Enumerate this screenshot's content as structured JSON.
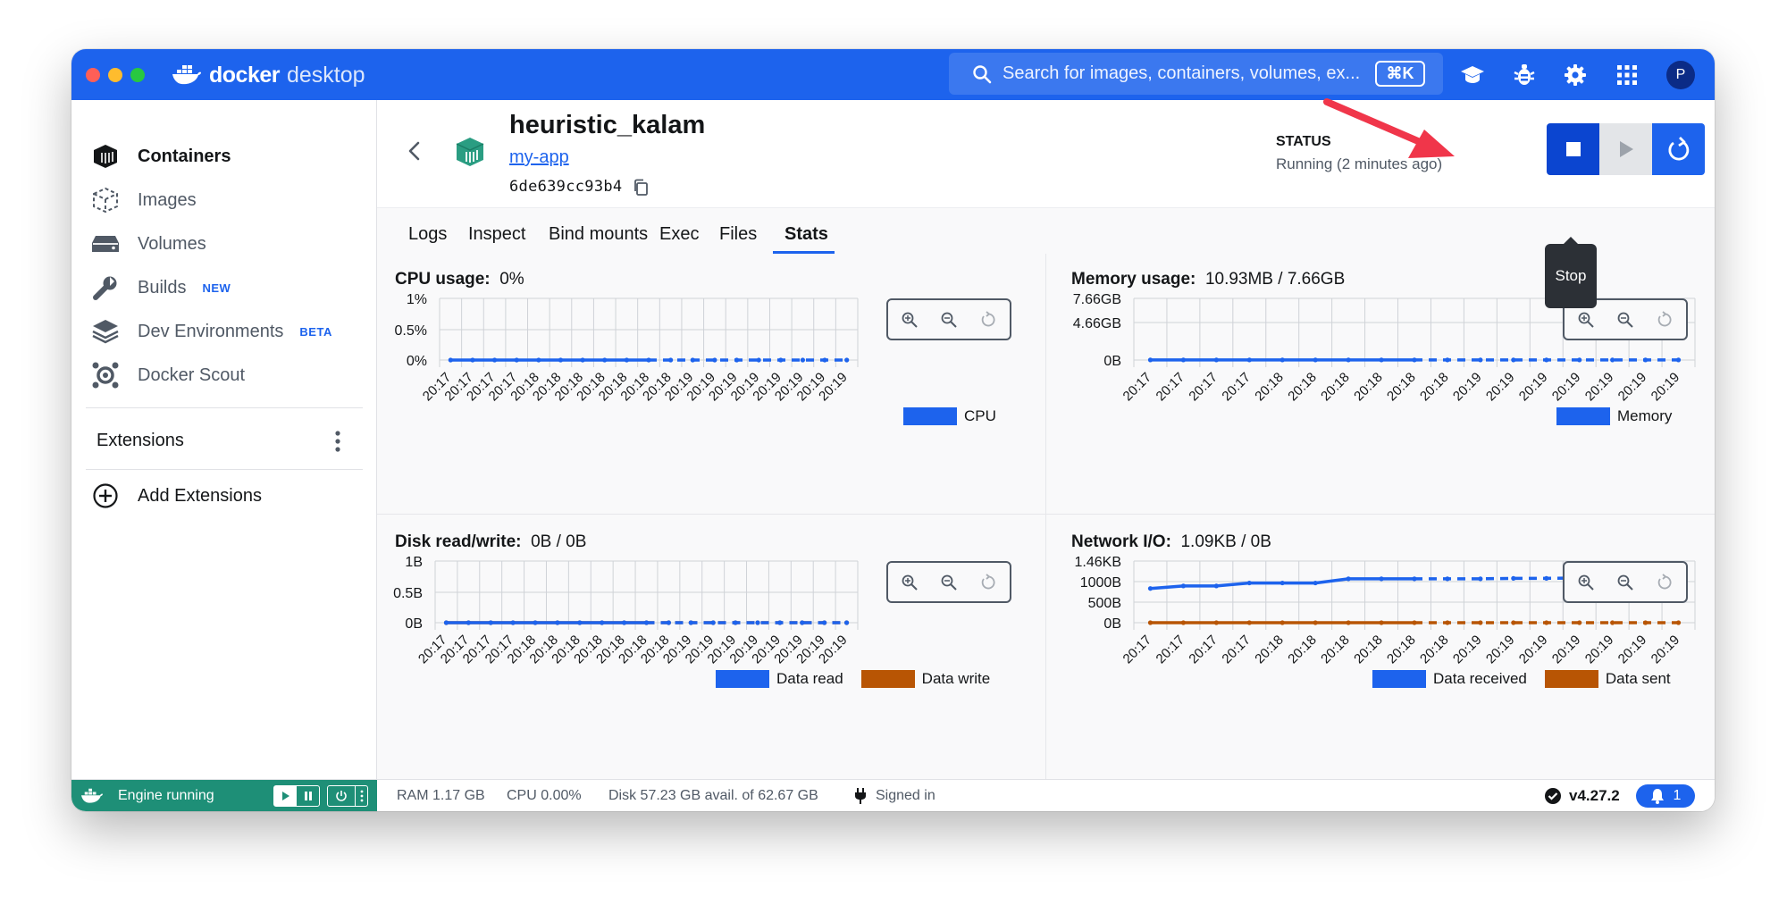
{
  "app": {
    "brand_bold": "docker",
    "brand_light": "desktop",
    "search_placeholder": "Search for images, containers, volumes, ex...",
    "search_shortcut": "⌘K",
    "avatar_initial": "P"
  },
  "sidebar": {
    "items": [
      {
        "label": "Containers",
        "icon": "containers-icon",
        "badge": ""
      },
      {
        "label": "Images",
        "icon": "images-icon",
        "badge": ""
      },
      {
        "label": "Volumes",
        "icon": "volumes-icon",
        "badge": ""
      },
      {
        "label": "Builds",
        "icon": "builds-icon",
        "badge": "NEW"
      },
      {
        "label": "Dev Environments",
        "icon": "dev-environments-icon",
        "badge": "BETA"
      },
      {
        "label": "Docker Scout",
        "icon": "docker-scout-icon",
        "badge": ""
      }
    ],
    "extensions_label": "Extensions",
    "add_extensions_label": "Add Extensions"
  },
  "container": {
    "name": "heuristic_kalam",
    "image": "my-app",
    "id": "6de639cc93b4",
    "status_label": "STATUS",
    "status_value": "Running (2 minutes ago)"
  },
  "controls": {
    "stop_tooltip": "Stop"
  },
  "tabs": [
    "Logs",
    "Inspect",
    "Bind mounts",
    "Exec",
    "Files",
    "Stats"
  ],
  "active_tab": "Stats",
  "colors": {
    "primary_blue": "#1d63ed",
    "data_write_orange": "#b85504",
    "delete_red": "#d52536",
    "engine_green": "#1e8f77"
  },
  "chart_data": [
    {
      "type": "line",
      "title_label": "CPU usage:",
      "title_value": "0%",
      "x": [
        "20:17",
        "20:17",
        "20:17",
        "20:17",
        "20:18",
        "20:18",
        "20:18",
        "20:18",
        "20:18",
        "20:18",
        "20:18",
        "20:19",
        "20:19",
        "20:19",
        "20:19",
        "20:19",
        "20:19",
        "20:19",
        "20:19"
      ],
      "y_ticks": [
        "1%",
        "0.5%",
        "0%"
      ],
      "ylim": [
        0,
        1
      ],
      "series": [
        {
          "name": "CPU",
          "values": [
            0,
            0,
            0,
            0,
            0,
            0,
            0,
            0,
            0,
            0,
            0,
            0,
            0,
            0,
            0,
            0,
            0,
            0,
            0
          ],
          "color": "#1d63ed"
        }
      ]
    },
    {
      "type": "line",
      "title_label": "Memory usage:",
      "title_value": "10.93MB / 7.66GB",
      "x": [
        "20:17",
        "20:17",
        "20:17",
        "20:17",
        "20:18",
        "20:18",
        "20:18",
        "20:18",
        "20:18",
        "20:18",
        "20:19",
        "20:19",
        "20:19",
        "20:19",
        "20:19",
        "20:19",
        "20:19"
      ],
      "y_ticks": [
        "7.66GB",
        "4.66GB",
        "0B"
      ],
      "ylim": [
        0,
        7.66
      ],
      "series": [
        {
          "name": "Memory",
          "values": [
            0.011,
            0.011,
            0.011,
            0.011,
            0.011,
            0.011,
            0.011,
            0.011,
            0.011,
            0.011,
            0.011,
            0.011,
            0.011,
            0.011,
            0.011,
            0.011,
            0.011
          ],
          "color": "#1d63ed"
        }
      ]
    },
    {
      "type": "line",
      "title_label": "Disk read/write:",
      "title_value": "0B / 0B",
      "x": [
        "20:17",
        "20:17",
        "20:17",
        "20:17",
        "20:18",
        "20:18",
        "20:18",
        "20:18",
        "20:18",
        "20:18",
        "20:18",
        "20:19",
        "20:19",
        "20:19",
        "20:19",
        "20:19",
        "20:19",
        "20:19",
        "20:19"
      ],
      "y_ticks": [
        "1B",
        "0.5B",
        "0B"
      ],
      "ylim": [
        0,
        1
      ],
      "series": [
        {
          "name": "Data read",
          "values": [
            0,
            0,
            0,
            0,
            0,
            0,
            0,
            0,
            0,
            0,
            0,
            0,
            0,
            0,
            0,
            0,
            0,
            0,
            0
          ],
          "color": "#1d63ed"
        },
        {
          "name": "Data write",
          "values": [
            0,
            0,
            0,
            0,
            0,
            0,
            0,
            0,
            0,
            0,
            0,
            0,
            0,
            0,
            0,
            0,
            0,
            0,
            0
          ],
          "color": "#b85504"
        }
      ]
    },
    {
      "type": "line",
      "title_label": "Network I/O:",
      "title_value": "1.09KB / 0B",
      "x": [
        "20:17",
        "20:17",
        "20:17",
        "20:17",
        "20:18",
        "20:18",
        "20:18",
        "20:18",
        "20:18",
        "20:18",
        "20:19",
        "20:19",
        "20:19",
        "20:19",
        "20:19",
        "20:19",
        "20:19"
      ],
      "y_ticks": [
        "1.46KB",
        "1000B",
        "500B",
        "0B"
      ],
      "ylim": [
        0,
        1460
      ],
      "series": [
        {
          "name": "Data received",
          "values": [
            810,
            870,
            870,
            940,
            940,
            940,
            1040,
            1040,
            1040,
            1040,
            1040,
            1050,
            1050,
            1060,
            1060,
            1070,
            1070
          ],
          "color": "#1d63ed"
        },
        {
          "name": "Data sent",
          "values": [
            0,
            0,
            0,
            0,
            0,
            0,
            0,
            0,
            0,
            0,
            0,
            0,
            0,
            0,
            0,
            0,
            0
          ],
          "color": "#b85504"
        }
      ]
    }
  ],
  "statusbar": {
    "engine_label": "Engine running",
    "ram": "RAM 1.17 GB",
    "cpu": "CPU 0.00%",
    "disk": "Disk 57.23 GB avail. of 62.67 GB",
    "signed_in": "Signed in",
    "version": "v4.27.2",
    "notifications": "1"
  }
}
